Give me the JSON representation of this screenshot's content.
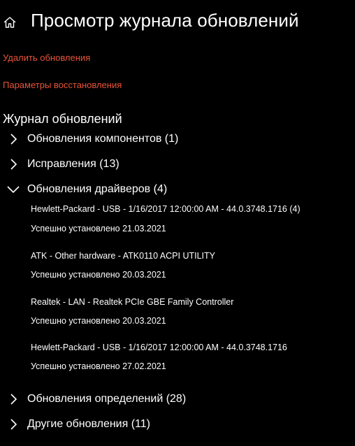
{
  "header": {
    "title": "Просмотр журнала обновлений",
    "home_icon": "home-icon"
  },
  "links": {
    "uninstall": "Удалить обновления",
    "recovery": "Параметры восстановления"
  },
  "colors": {
    "background": "#000000",
    "text": "#ffffff",
    "link": "#e8543a"
  },
  "history": {
    "title": "Журнал обновлений",
    "groups": [
      {
        "label": "Обновления компонентов (1)",
        "expanded": false
      },
      {
        "label": "Исправления (13)",
        "expanded": false
      },
      {
        "label": "Обновления драйверов (4)",
        "expanded": true
      },
      {
        "label": "Обновления определений (28)",
        "expanded": false
      },
      {
        "label": "Другие обновления (11)",
        "expanded": false
      }
    ],
    "driver_updates": [
      {
        "name": "Hewlett-Packard - USB - 1/16/2017 12:00:00 AM - 44.0.3748.1716 (4)",
        "status": "Успешно установлено 21.03.2021"
      },
      {
        "name": "ATK - Other hardware - ATK0110 ACPI UTILITY",
        "status": "Успешно установлено 20.03.2021"
      },
      {
        "name": "Realtek - LAN - Realtek PCIe GBE Family Controller",
        "status": "Успешно установлено 20.03.2021"
      },
      {
        "name": "Hewlett-Packard - USB - 1/16/2017 12:00:00 AM - 44.0.3748.1716",
        "status": "Успешно установлено 27.02.2021"
      }
    ]
  }
}
